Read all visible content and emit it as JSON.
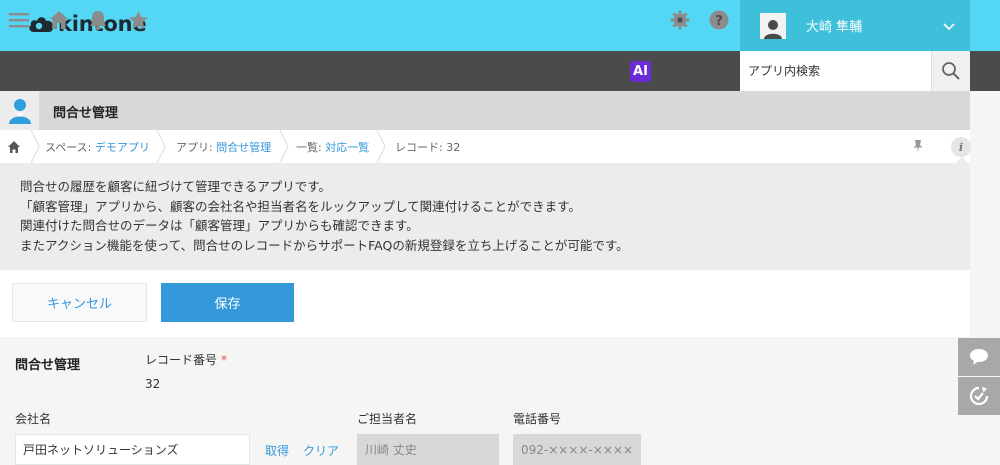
{
  "header": {
    "logo_text": "kintone",
    "user_name": "大崎 隼輔"
  },
  "nav": {
    "ai_label": "AI",
    "search_placeholder": "アプリ内検索"
  },
  "app": {
    "title": "問合せ管理"
  },
  "breadcrumb": {
    "space_prefix": "スペース: ",
    "space_name": "デモアプリ",
    "app_prefix": "アプリ: ",
    "app_name": "問合せ管理",
    "view_prefix": "一覧: ",
    "view_name": "対応一覧",
    "record": "レコード: 32"
  },
  "description": {
    "lines": [
      "問合せの履歴を顧客に紐づけて管理できるアプリです。",
      "「顧客管理」アプリから、顧客の会社名や担当者名をルックアップして関連付けることができます。",
      "関連付けた問合せのデータは「顧客管理」アプリからも確認できます。",
      "またアクション機能を使って、問合せのレコードからサポートFAQの新規登録を立ち上げることが可能です。"
    ]
  },
  "actions": {
    "cancel_label": "キャンセル",
    "save_label": "保存"
  },
  "form": {
    "section_title": "問合せ管理",
    "record_no_label": "レコード番号",
    "required_mark": "*",
    "record_no_value": "32",
    "company_label": "会社名",
    "company_value": "戸田ネットソリューションズ",
    "fetch_label": "取得",
    "clear_label": "クリア",
    "contact_label": "ご担当者名",
    "contact_value": "川崎 丈史",
    "phone_label": "電話番号",
    "phone_value": "092-××××-××××"
  },
  "colors": {
    "topbar": "#54d6f5",
    "userbox": "#3ec0db",
    "navbar": "#4b4b4b",
    "accent": "#3498db",
    "ai_badge": "#6b2bd6",
    "required": "#e74c3c"
  }
}
